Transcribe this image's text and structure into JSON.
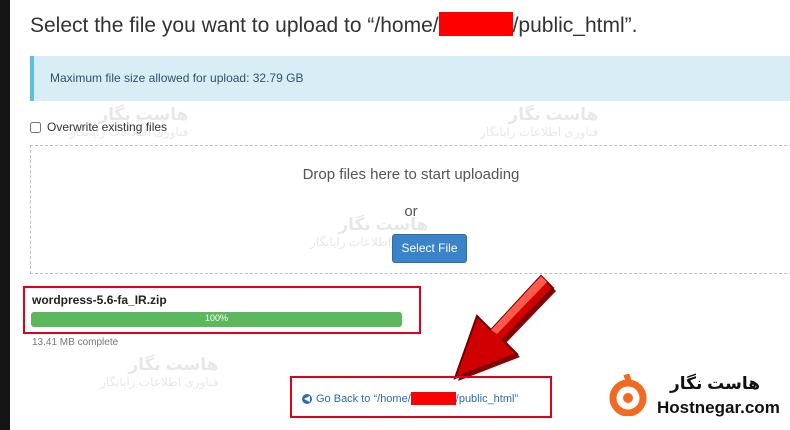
{
  "header": {
    "title_prefix": "Select the file you want to upload to “/home/",
    "title_suffix": "/public_html”."
  },
  "alert": {
    "text": "Maximum file size allowed for upload: 32.79 GB"
  },
  "overwrite": {
    "label": "Overwrite existing files",
    "checked": false
  },
  "dropzone": {
    "drop_text": "Drop files here to start uploading",
    "or_text": "or",
    "select_button": "Select File"
  },
  "upload": {
    "file_name": "wordpress-5.6-fa_IR.zip",
    "progress_label": "100%",
    "progress_percent": 100,
    "complete_text": "13.41 MB complete"
  },
  "go_back": {
    "prefix": "Go Back to “/home/",
    "suffix": "/public_html”"
  },
  "watermark": {
    "brand_fa": "هاست نگار",
    "brand_sub": "فناوری اطلاعات رایانگار"
  },
  "brand": {
    "name_fa": "هاست نگار",
    "name_en": "Hostnegar.com"
  },
  "colors": {
    "accent": "#3a83c9",
    "progress": "#5cb85c",
    "highlight": "#e0001b",
    "redaction": "#ff0000",
    "logo": "#f26a21"
  },
  "icons": {
    "go_back": "circle-arrow-left-icon",
    "annotation": "red-arrow-icon"
  }
}
